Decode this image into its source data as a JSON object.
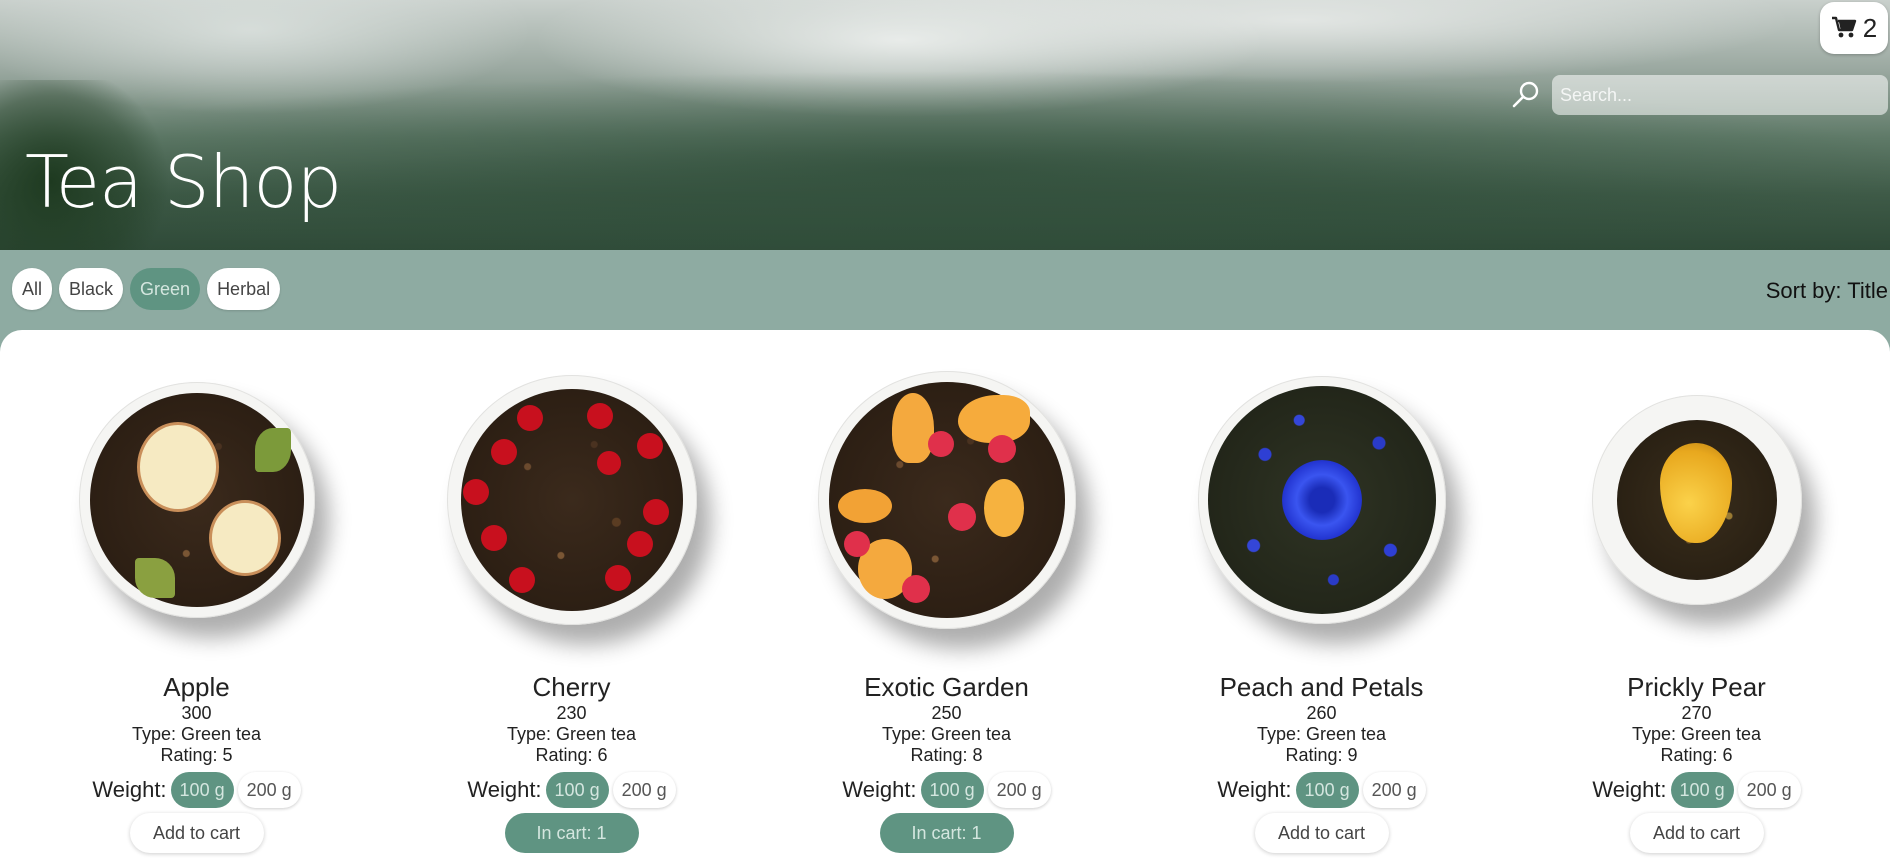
{
  "header": {
    "title": "Tea Shop",
    "cart_count": "2",
    "search_placeholder": "Search..."
  },
  "filters": [
    {
      "label": "All",
      "active": false
    },
    {
      "label": "Black",
      "active": false
    },
    {
      "label": "Green",
      "active": true
    },
    {
      "label": "Herbal",
      "active": false
    }
  ],
  "sort_label": "Sort by: Title",
  "weight_label": "Weight:",
  "colors": {
    "accent": "#5f9482",
    "bar": "#8eaba2"
  },
  "products": [
    {
      "name": "Apple",
      "price": "300",
      "type": "Type: Green tea",
      "rating": "Rating: 5",
      "weights": [
        "100 g",
        "200 g"
      ],
      "selected_weight": "100 g",
      "button": "Add to cart",
      "in_cart": false,
      "decor": "apple"
    },
    {
      "name": "Cherry",
      "price": "230",
      "type": "Type: Green tea",
      "rating": "Rating: 6",
      "weights": [
        "100 g",
        "200 g"
      ],
      "selected_weight": "100 g",
      "button": "In cart: 1",
      "in_cart": true,
      "decor": "cherry"
    },
    {
      "name": "Exotic Garden",
      "price": "250",
      "type": "Type: Green tea",
      "rating": "Rating: 8",
      "weights": [
        "100 g",
        "200 g"
      ],
      "selected_weight": "100 g",
      "button": "In cart: 1",
      "in_cart": true,
      "decor": "exotic"
    },
    {
      "name": "Peach and Petals",
      "price": "260",
      "type": "Type: Green tea",
      "rating": "Rating: 9",
      "weights": [
        "100 g",
        "200 g"
      ],
      "selected_weight": "100 g",
      "button": "Add to cart",
      "in_cart": false,
      "decor": "petals"
    },
    {
      "name": "Prickly Pear",
      "price": "270",
      "type": "Type: Green tea",
      "rating": "Rating: 6",
      "weights": [
        "100 g",
        "200 g"
      ],
      "selected_weight": "100 g",
      "button": "Add to cart",
      "in_cart": false,
      "decor": "pear"
    }
  ]
}
